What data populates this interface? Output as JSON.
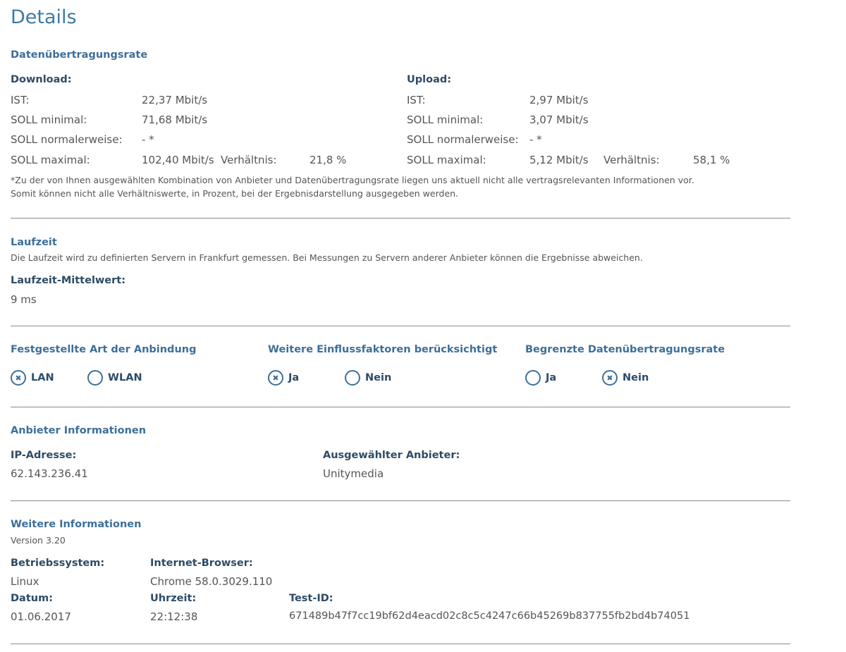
{
  "page_title": "Details",
  "rate": {
    "heading": "Datenübertragungsrate",
    "download": {
      "heading": "Download:",
      "ist_label": "IST:",
      "ist_value": "22,37 Mbit/s",
      "min_label": "SOLL minimal:",
      "min_value": "71,68 Mbit/s",
      "normal_label": "SOLL normalerweise:",
      "normal_value": "- *",
      "max_label": "SOLL maximal:",
      "max_value": "102,40 Mbit/s",
      "ratio_label": "Verhältnis:",
      "ratio_value": "21,8 %"
    },
    "upload": {
      "heading": "Upload:",
      "ist_label": "IST:",
      "ist_value": "2,97 Mbit/s",
      "min_label": "SOLL minimal:",
      "min_value": "3,07 Mbit/s",
      "normal_label": "SOLL normalerweise:",
      "normal_value": "- *",
      "max_label": "SOLL maximal:",
      "max_value": "5,12 Mbit/s",
      "ratio_label": "Verhältnis:",
      "ratio_value": "58,1 %"
    },
    "footnote_line1": "*Zu der von Ihnen ausgewählten Kombination von Anbieter und Datenübertragungsrate liegen uns aktuell nicht alle vertragsrelevanten Informationen vor.",
    "footnote_line2": "Somit können nicht alle Verhältniswerte, in Prozent, bei der Ergebnisdarstellung ausgegeben werden."
  },
  "latency": {
    "heading": "Laufzeit",
    "description": "Die Laufzeit wird zu definierten Servern in Frankfurt gemessen. Bei Messungen zu Servern anderer Anbieter können die Ergebnisse abweichen.",
    "mean_label": "Laufzeit-Mittelwert:",
    "mean_value": "9 ms"
  },
  "factors": {
    "connection": {
      "heading": "Festgestellte Art der Anbindung",
      "opt1": "LAN",
      "opt2": "WLAN",
      "selected": "LAN"
    },
    "influence": {
      "heading": "Weitere Einflussfaktoren berücksichtigt",
      "opt1": "Ja",
      "opt2": "Nein",
      "selected": "Ja"
    },
    "limited": {
      "heading": "Begrenzte Datenübertragungsrate",
      "opt1": "Ja",
      "opt2": "Nein",
      "selected": "Nein"
    },
    "checked_mark": "✖"
  },
  "provider": {
    "heading": "Anbieter Informationen",
    "ip_label": "IP-Adresse:",
    "ip_value": "62.143.236.41",
    "selected_label": "Ausgewählter Anbieter:",
    "selected_value": "Unitymedia"
  },
  "more": {
    "heading": "Weitere Informationen",
    "version": "Version 3.20",
    "os_label": "Betriebssystem:",
    "os_value": "Linux",
    "browser_label": "Internet-Browser:",
    "browser_value": "Chrome 58.0.3029.110",
    "date_label": "Datum:",
    "date_value": "01.06.2017",
    "time_label": "Uhrzeit:",
    "time_value": "22:12:38",
    "testid_label": "Test-ID:",
    "testid_value": "671489b47f7cc19bf62d4eacd02c8c5c4247c66b45269b837755fb2bd4b74051"
  },
  "colors": {
    "heading_blue": "#3d7aa8",
    "label_navy": "#2d4b66",
    "text_gray": "#555555"
  }
}
